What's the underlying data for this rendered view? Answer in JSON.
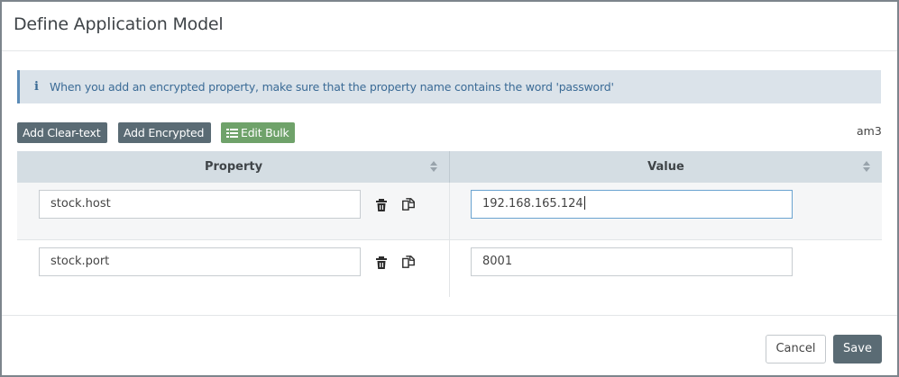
{
  "dialog": {
    "title": "Define Application Model"
  },
  "info": {
    "icon": "info-icon",
    "text": "When you add an encrypted property, make sure that the property name contains the word 'password'"
  },
  "toolbar": {
    "add_clear_label": "Add Clear-text",
    "add_encrypted_label": "Add Encrypted",
    "edit_bulk_label": "Edit Bulk",
    "model_name": "am3"
  },
  "table": {
    "columns": [
      "Property",
      "Value"
    ],
    "rows": [
      {
        "property": "stock.host",
        "value": "192.168.165.124"
      },
      {
        "property": "stock.port",
        "value": "8001"
      }
    ]
  },
  "footer": {
    "cancel_label": "Cancel",
    "save_label": "Save"
  },
  "colors": {
    "info_bg": "#dbe3ea",
    "info_text": "#3b6b96",
    "button_dark": "#5a6b74",
    "button_green": "#6fa26a",
    "header_bg": "#d4dde3"
  }
}
